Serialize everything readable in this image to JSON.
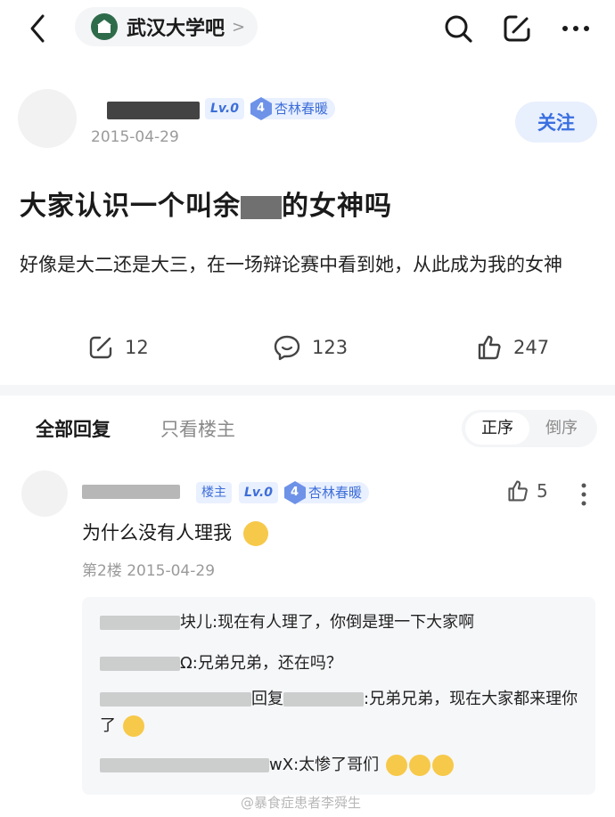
{
  "header": {
    "forum_name": "武汉大学吧",
    "icons": [
      "back-icon",
      "search-icon",
      "edit-icon",
      "more-icon"
    ]
  },
  "post": {
    "level": "Lv.0",
    "fan_level": "4",
    "fan_title": "杏林春暖",
    "date": "2015-04-29",
    "follow_label": "关注",
    "title": "大家认识一个叫余",
    "title_tail": "的女神吗",
    "body": "好像是大二还是大三，在一场辩论赛中看到她，从此成为我的女神",
    "stats": {
      "shares": "12",
      "comments": "123",
      "likes": "247"
    }
  },
  "tabs": {
    "all": "全部回复",
    "op_only": "只看楼主",
    "sort_asc": "正序",
    "sort_desc": "倒序"
  },
  "reply": {
    "host_badge": "楼主",
    "level": "Lv.0",
    "fan_level": "4",
    "fan_title": "杏林春暖",
    "likes": "5",
    "text": "为什么没有人理我",
    "meta": "第2楼 2015-04-29",
    "subs": [
      {
        "name_tail": "块儿",
        "text": ":现在有人理了，你倒是理一下大家啊"
      },
      {
        "name_tail": "Ω",
        "text": ":兄弟兄弟，还在吗？"
      },
      {
        "name_tail": "回复",
        "text": ":兄弟兄弟，现在大家都来理你了"
      },
      {
        "name_tail": "wX",
        "text": ":太惨了哥们"
      }
    ]
  },
  "watermark": "@暴食症患者李舜生"
}
